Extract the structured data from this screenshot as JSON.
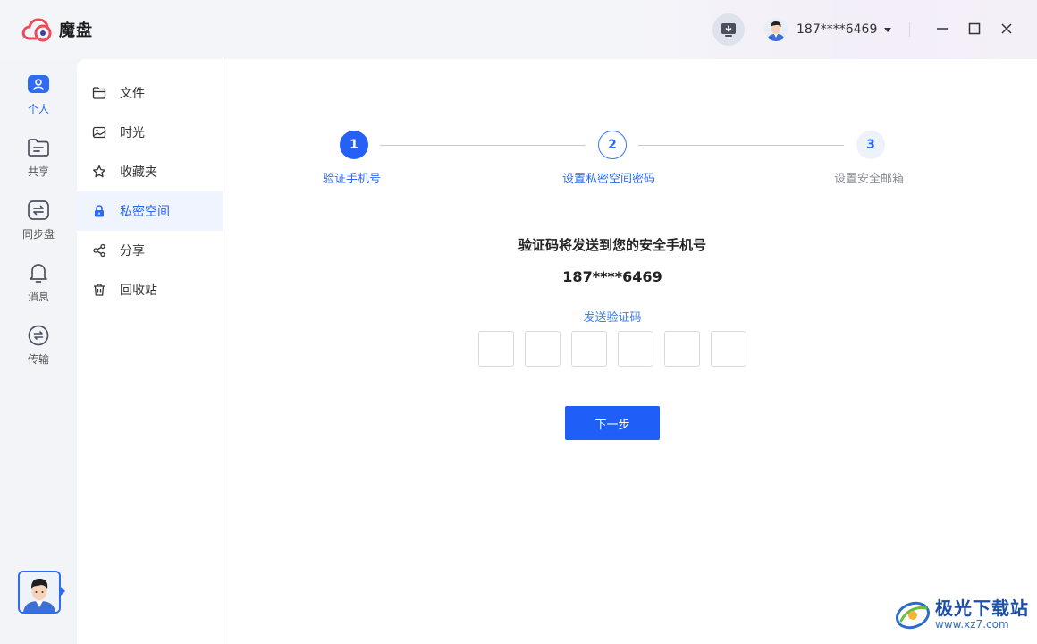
{
  "app": {
    "name": "魔盘"
  },
  "header": {
    "user_phone": "187****6469",
    "icons": [
      "download-icon",
      "minimize-icon",
      "maximize-icon",
      "close-icon"
    ]
  },
  "rail": {
    "items": [
      {
        "label": "个人",
        "icon": "person-icon",
        "active": true
      },
      {
        "label": "共享",
        "icon": "folder-share-icon"
      },
      {
        "label": "同步盘",
        "icon": "sync-icon"
      },
      {
        "label": "消息",
        "icon": "bell-icon"
      },
      {
        "label": "传输",
        "icon": "transfer-icon"
      }
    ]
  },
  "nav": {
    "items": [
      {
        "label": "文件",
        "icon": "folder-icon"
      },
      {
        "label": "时光",
        "icon": "image-icon"
      },
      {
        "label": "收藏夹",
        "icon": "star-icon"
      },
      {
        "label": "私密空间",
        "icon": "lock-icon",
        "active": true
      },
      {
        "label": "分享",
        "icon": "share-icon"
      },
      {
        "label": "回收站",
        "icon": "trash-icon"
      }
    ]
  },
  "steps": [
    {
      "num": "1",
      "label": "验证手机号",
      "state": "current"
    },
    {
      "num": "2",
      "label": "设置私密空间密码",
      "state": "upcoming"
    },
    {
      "num": "3",
      "label": "设置安全邮箱",
      "state": "upcoming"
    }
  ],
  "verify": {
    "hint": "验证码将发送到您的安全手机号",
    "phone": "187****6469",
    "send_code": "发送验证码",
    "code_length": 6,
    "next_button": "下一步"
  },
  "watermark": {
    "title": "极光下载站",
    "url": "www.xz7.com"
  },
  "colors": {
    "accent": "#2561f5",
    "link": "#3c82e6",
    "muted": "#8a8d93"
  }
}
